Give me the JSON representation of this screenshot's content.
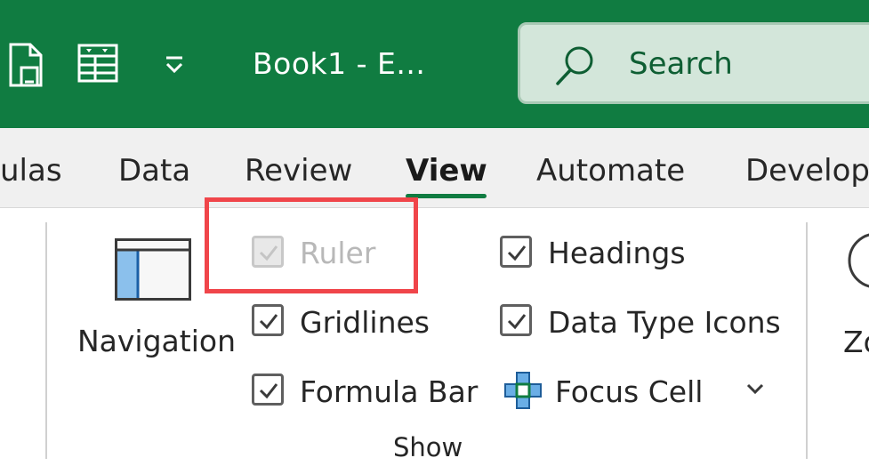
{
  "window": {
    "title": "Book1  -  E..."
  },
  "search": {
    "label": "Search"
  },
  "tabs": [
    {
      "label": "ulas"
    },
    {
      "label": "Data"
    },
    {
      "label": "Review"
    },
    {
      "label": "View",
      "active": true
    },
    {
      "label": "Automate"
    },
    {
      "label": "Develop"
    }
  ],
  "ribbon": {
    "navigation_label": "Navigation",
    "show_group": {
      "name": "Show",
      "ruler": {
        "label": "Ruler",
        "checked": true,
        "disabled": true
      },
      "gridlines": {
        "label": "Gridlines",
        "checked": true
      },
      "formula_bar": {
        "label": "Formula Bar",
        "checked": true
      },
      "headings": {
        "label": "Headings",
        "checked": true
      },
      "data_type_icons": {
        "label": "Data Type Icons",
        "checked": true
      },
      "focus_cell": {
        "label": "Focus Cell"
      }
    },
    "zoom_label": "Zo"
  },
  "colors": {
    "brand": "#107c41",
    "highlight": "#f0454a"
  }
}
